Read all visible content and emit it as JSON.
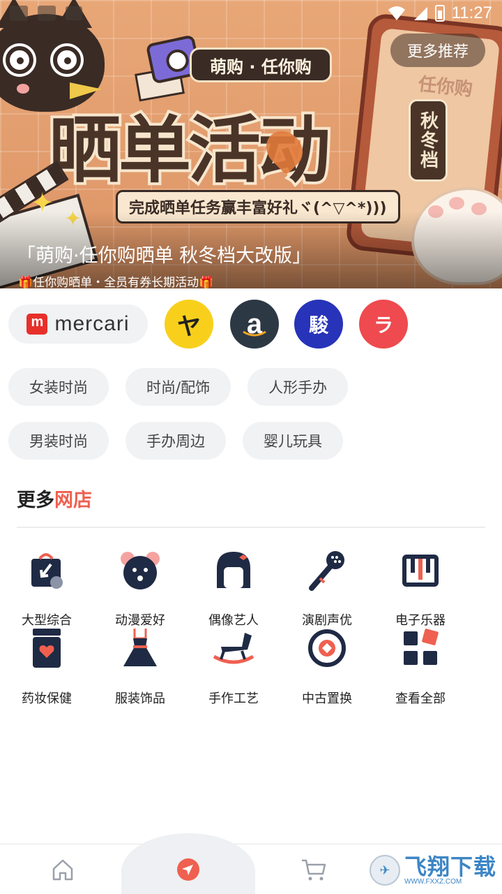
{
  "status_bar": {
    "time": "11:27"
  },
  "banner": {
    "more_button": "更多推荐",
    "tag": "萌购 · 任你购",
    "title": "晒单活动",
    "season": "秋冬档",
    "subtitle": "完成晒单任务赢丰富好礼ヾ(^▽^*)))",
    "phone_logo": "任你购",
    "caption": "「萌购·任你购晒单 秋冬档大改版」",
    "subcaption": "🎁任你购晒单・全员有券长期活动🎁"
  },
  "stores": {
    "mercari_label": "mercari",
    "yahoo_glyph": "ヤ",
    "amazon_glyph": "a",
    "surugaya_glyph": "駿",
    "rakuma_glyph": "ラ"
  },
  "chips": {
    "row1": [
      "女装时尚",
      "时尚/配饰",
      "人形手办"
    ],
    "row2": [
      "男装时尚",
      "手办周边",
      "婴儿玩具"
    ]
  },
  "section": {
    "title_prefix": "更多",
    "title_accent": "网店"
  },
  "shop_categories": [
    {
      "label": "大型综合",
      "icon": "shopping-bag-icon"
    },
    {
      "label": "动漫爱好",
      "icon": "bear-icon"
    },
    {
      "label": "偶像艺人",
      "icon": "idol-icon"
    },
    {
      "label": "演剧声优",
      "icon": "microphone-icon"
    },
    {
      "label": "电子乐器",
      "icon": "piano-icon"
    },
    {
      "label": "药妆保健",
      "icon": "medicine-jar-icon"
    },
    {
      "label": "服装饰品",
      "icon": "dress-icon"
    },
    {
      "label": "手作工艺",
      "icon": "rocking-horse-icon"
    },
    {
      "label": "中古置换",
      "icon": "exchange-icon"
    },
    {
      "label": "查看全部",
      "icon": "grid-icon"
    }
  ],
  "bottom_nav": {
    "items": [
      "home-icon",
      "navigate-icon",
      "cart-icon"
    ],
    "watermark_text": "飞翔下载",
    "watermark_url": "WWW.FXXZ.COM"
  },
  "colors": {
    "accent": "#ef6050",
    "dark": "#1f2a44",
    "chip_bg": "#f1f2f4"
  }
}
